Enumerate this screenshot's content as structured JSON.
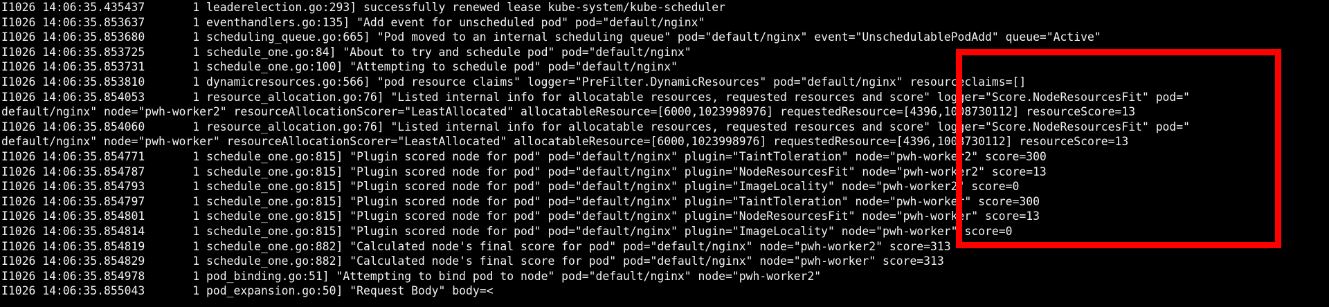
{
  "terminal": {
    "background": "#000000",
    "text_color": "#f2f2f2",
    "annotation_color": "#ff0000",
    "lines": [
      "I1026 14:06:35.435437       1 leaderelection.go:293] successfully renewed lease kube-system/kube-scheduler",
      "I1026 14:06:35.853637       1 eventhandlers.go:135] \"Add event for unscheduled pod\" pod=\"default/nginx\"",
      "I1026 14:06:35.853680       1 scheduling_queue.go:665] \"Pod moved to an internal scheduling queue\" pod=\"default/nginx\" event=\"UnschedulablePodAdd\" queue=\"Active\"",
      "I1026 14:06:35.853725       1 schedule_one.go:84] \"About to try and schedule pod\" pod=\"default/nginx\"",
      "I1026 14:06:35.853731       1 schedule_one.go:100] \"Attempting to schedule pod\" pod=\"default/nginx\"",
      "I1026 14:06:35.853810       1 dynamicresources.go:566] \"pod resource claims\" logger=\"PreFilter.DynamicResources\" pod=\"default/nginx\" resourceclaims=[]",
      "I1026 14:06:35.854053       1 resource_allocation.go:76] \"Listed internal info for allocatable resources, requested resources and score\" logger=\"Score.NodeResourcesFit\" pod=\"",
      "default/nginx\" node=\"pwh-worker2\" resourceAllocationScorer=\"LeastAllocated\" allocatableResource=[6000,1023998976] requestedResource=[4396,1008730112] resourceScore=13",
      "I1026 14:06:35.854060       1 resource_allocation.go:76] \"Listed internal info for allocatable resources, requested resources and score\" logger=\"Score.NodeResourcesFit\" pod=\"",
      "default/nginx\" node=\"pwh-worker\" resourceAllocationScorer=\"LeastAllocated\" allocatableResource=[6000,1023998976] requestedResource=[4396,1008730112] resourceScore=13",
      "I1026 14:06:35.854771       1 schedule_one.go:815] \"Plugin scored node for pod\" pod=\"default/nginx\" plugin=\"TaintToleration\" node=\"pwh-worker2\" score=300",
      "I1026 14:06:35.854787       1 schedule_one.go:815] \"Plugin scored node for pod\" pod=\"default/nginx\" plugin=\"NodeResourcesFit\" node=\"pwh-worker2\" score=13",
      "I1026 14:06:35.854793       1 schedule_one.go:815] \"Plugin scored node for pod\" pod=\"default/nginx\" plugin=\"ImageLocality\" node=\"pwh-worker2\" score=0",
      "I1026 14:06:35.854797       1 schedule_one.go:815] \"Plugin scored node for pod\" pod=\"default/nginx\" plugin=\"TaintToleration\" node=\"pwh-worker\" score=300",
      "I1026 14:06:35.854801       1 schedule_one.go:815] \"Plugin scored node for pod\" pod=\"default/nginx\" plugin=\"NodeResourcesFit\" node=\"pwh-worker\" score=13",
      "I1026 14:06:35.854814       1 schedule_one.go:815] \"Plugin scored node for pod\" pod=\"default/nginx\" plugin=\"ImageLocality\" node=\"pwh-worker\" score=0",
      "I1026 14:06:35.854819       1 schedule_one.go:882] \"Calculated node's final score for pod\" pod=\"default/nginx\" node=\"pwh-worker2\" score=313",
      "I1026 14:06:35.854829       1 schedule_one.go:882] \"Calculated node's final score for pod\" pod=\"default/nginx\" node=\"pwh-worker\" score=313",
      "I1026 14:06:35.854978       1 pod_binding.go:51] \"Attempting to bind pod to node\" pod=\"default/nginx\" node=\"pwh-worker2\"",
      "I1026 14:06:35.855043       1 pod_expansion.go:50] \"Request Body\" body=<"
    ]
  }
}
